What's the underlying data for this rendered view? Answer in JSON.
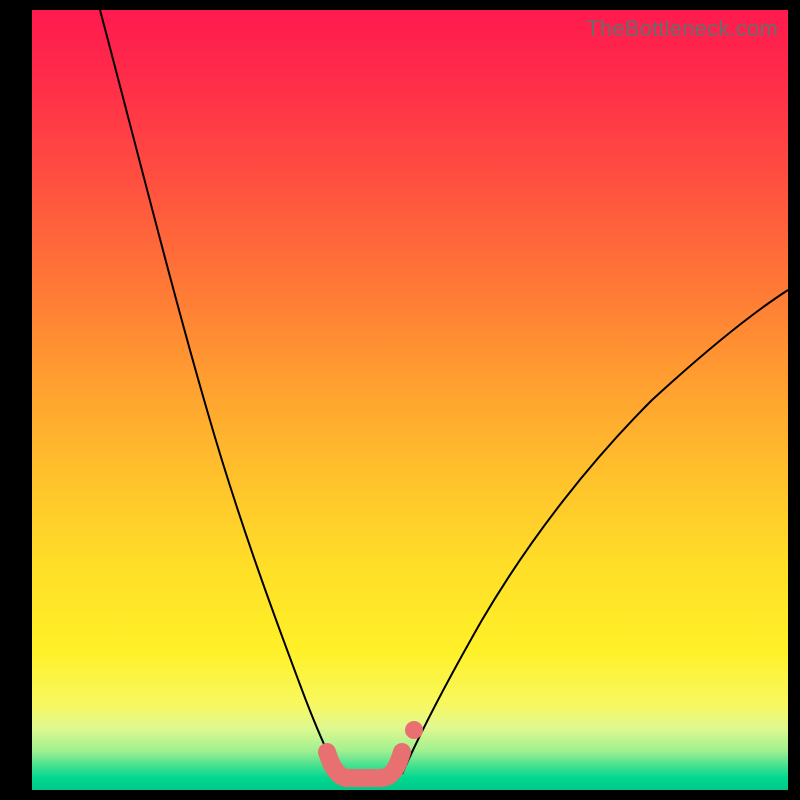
{
  "watermark": "TheBottleneck.com",
  "colors": {
    "background": "#000000",
    "curve": "#000000",
    "marker": "#e97070"
  },
  "chart_data": {
    "type": "line",
    "title": "",
    "xlabel": "",
    "ylabel": "",
    "xlim": [
      0,
      100
    ],
    "ylim": [
      0,
      100
    ],
    "grid": false,
    "series": [
      {
        "name": "left-curve",
        "x": [
          9,
          12,
          15,
          18,
          21,
          24,
          27,
          30,
          33,
          36,
          39,
          40.5
        ],
        "y": [
          100,
          90,
          79,
          68,
          58,
          48,
          38,
          29,
          20,
          12,
          5,
          2
        ]
      },
      {
        "name": "right-curve",
        "x": [
          49,
          52,
          56,
          60,
          65,
          70,
          76,
          82,
          88,
          94,
          100
        ],
        "y": [
          2,
          6,
          12,
          19,
          27,
          34,
          42,
          49,
          55,
          60,
          64
        ]
      },
      {
        "name": "thumb-track",
        "x": [
          39,
          40,
          41.5,
          44,
          46,
          48,
          49
        ],
        "y": [
          5,
          2.5,
          1.6,
          1.6,
          1.6,
          2.4,
          5
        ]
      }
    ],
    "markers": [
      {
        "name": "thumb-dot-upper",
        "x": 50.5,
        "y": 7.8
      }
    ],
    "legend": false,
    "annotations": []
  }
}
